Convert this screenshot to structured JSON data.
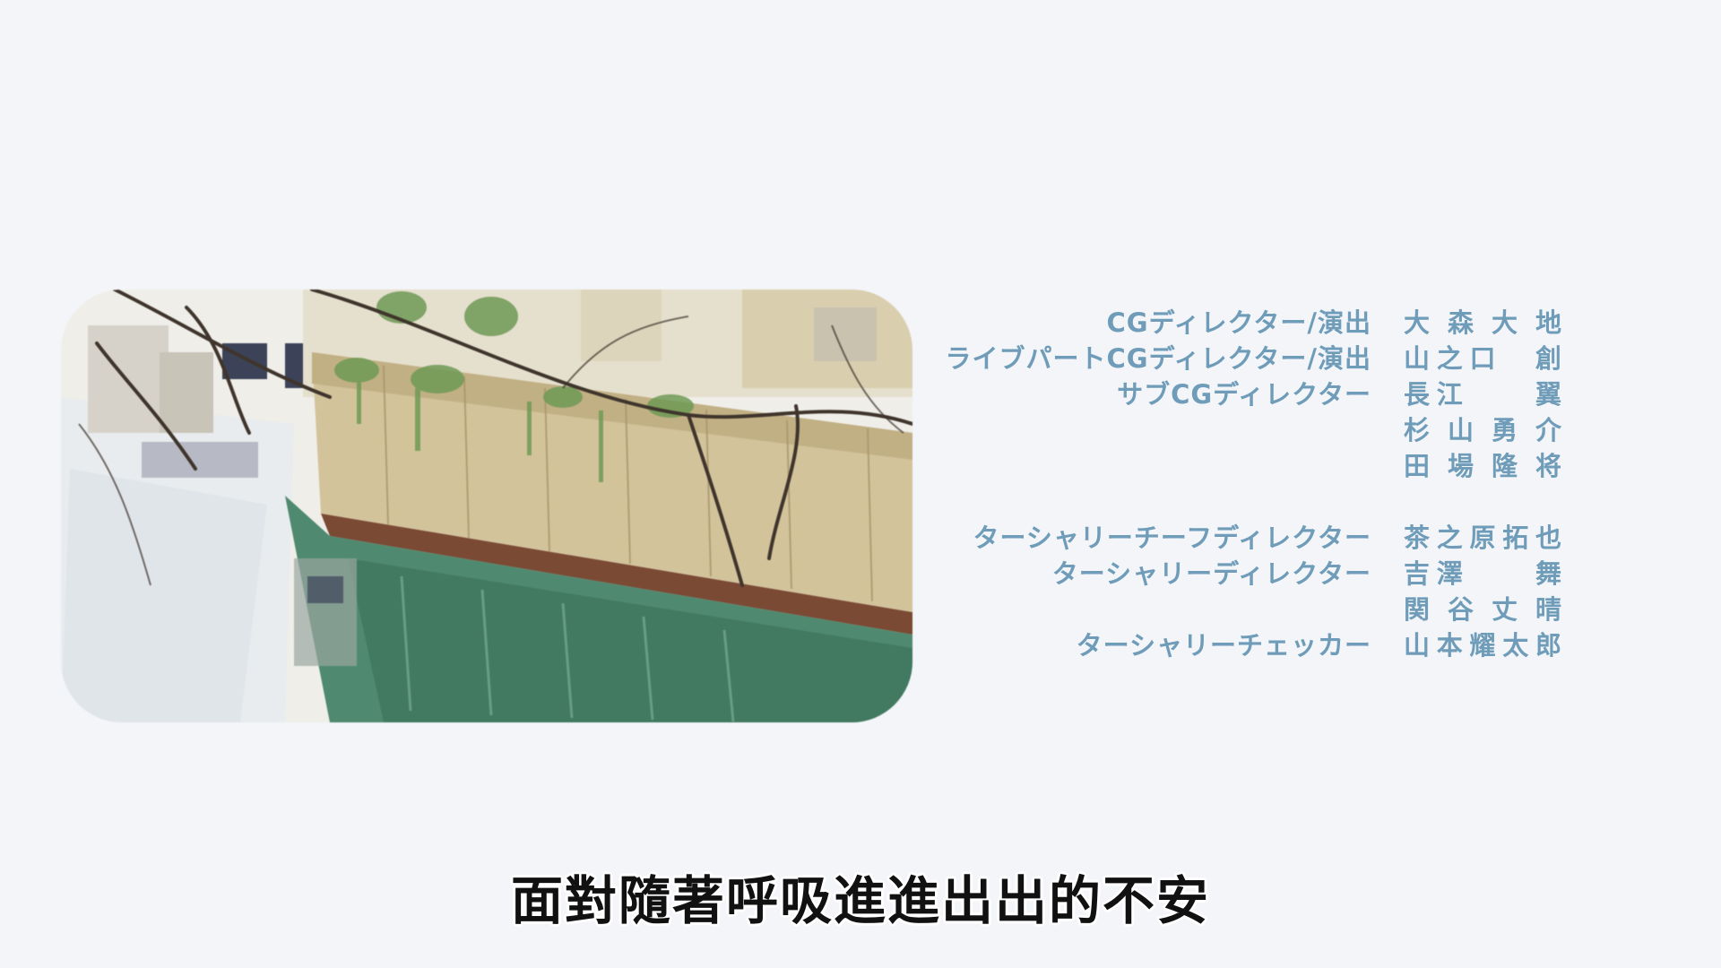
{
  "image": {
    "description": "Watercolor illustration of an urban canal with concrete walls, ivy, bare branches and buildings reflected in green water",
    "palette": {
      "sky": "#f2f2ee",
      "wall": "#d3c39b",
      "water": "#4f8a70",
      "ivy": "#6f9a55",
      "branches": "#3f352c"
    }
  },
  "credits": [
    {
      "role": "CGディレクター/演出",
      "name": "大森大地"
    },
    {
      "role": "ライブパートCGディレクター/演出",
      "name": "山之口　創"
    },
    {
      "role": "サブCGディレクター",
      "name": "長江　　翼"
    },
    {
      "role": "",
      "name": "杉山勇介"
    },
    {
      "role": "",
      "name": "田場隆将"
    },
    {
      "role": "ターシャリーチーフディレクター",
      "name": "茶之原拓也"
    },
    {
      "role": "ターシャリーディレクター",
      "name": "吉澤　　舞"
    },
    {
      "role": "",
      "name": "関谷丈晴"
    },
    {
      "role": "ターシャリーチェッカー",
      "name": "山本耀太郎"
    }
  ],
  "subtitle": "面對隨著呼吸進進出出的不安",
  "colors": {
    "background": "#f3f5f9",
    "credit_text": "#6f9cb8",
    "subtitle_text": "#111111",
    "subtitle_outline": "#ffffff"
  }
}
